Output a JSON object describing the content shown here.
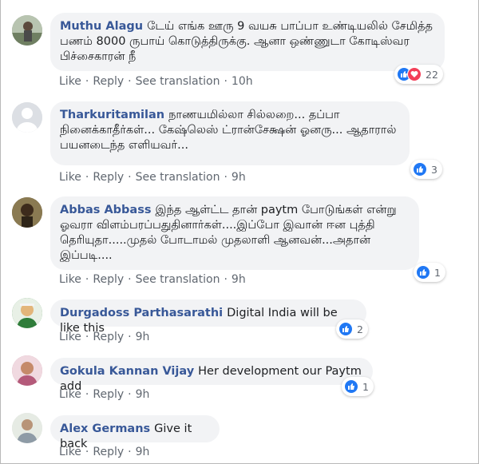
{
  "comments": [
    {
      "author": "Muthu Alagu",
      "text": "டேய் எங்க ஊரு 9 வயசு பாப்பா உண்டியலில் சேமித்த பணம் 8000 ருபாய் கொடுத்திருக்கு. ஆனா ஒண்ணுடா கோடிஸ்வர பிச்சைகாரன் நீ",
      "actions": {
        "like": "Like",
        "reply": "Reply",
        "translate": "See translation",
        "time": "10h"
      },
      "reactions": {
        "types": [
          "like-icon",
          "love-icon"
        ],
        "count": "22"
      },
      "avatar_color": "#8c9a86"
    },
    {
      "author": "Tharkuritamilan",
      "text": "நாணயமில்லா சில்லறை... தப்பா நினைக்காதீர்கள்... கேஷ்லெஸ் ட்ரான்சேக்ஷன் ஓனரு... ஆதாரால் பயனடைந்த எளியவர்...",
      "actions": {
        "like": "Like",
        "reply": "Reply",
        "translate": "See translation",
        "time": "9h"
      },
      "reactions": {
        "types": [
          "like-icon"
        ],
        "count": "3"
      },
      "avatar_color": "#dddfe2"
    },
    {
      "author": "Abbas Abbass",
      "text": "இந்த ஆள்ட்ட தான் paytm போடுங்கள் என்று ஓவரா விளம்பரப்பதுதினார்கள்....இப்போ இவான் ஈன புத்தி தெரியுதா.....முதல் போடாமல் முதலாளி ஆனவன்...அதான் இப்படி....",
      "actions": {
        "like": "Like",
        "reply": "Reply",
        "translate": "See translation",
        "time": "9h"
      },
      "reactions": {
        "types": [
          "like-icon"
        ],
        "count": "1"
      },
      "avatar_color": "#6b5a3a"
    },
    {
      "author": "Durgadoss Parthasarathi",
      "text": "Digital India will be like this",
      "actions": {
        "like": "Like",
        "reply": "Reply",
        "time": "9h"
      },
      "reactions": {
        "types": [
          "like-icon"
        ],
        "count": "2"
      },
      "avatar_color": "#3a8a4a"
    },
    {
      "author": "Gokula Kannan Vijay",
      "text": "Her development our Paytm add",
      "actions": {
        "like": "Like",
        "reply": "Reply",
        "time": "9h"
      },
      "reactions": {
        "types": [
          "like-icon"
        ],
        "count": "1"
      },
      "avatar_color": "#c98aa0"
    },
    {
      "author": "Alex Germans",
      "text": "Give it back",
      "actions": {
        "like": "Like",
        "reply": "Reply",
        "time": "9h"
      },
      "avatar_color": "#d8ded6"
    }
  ],
  "separator": "·"
}
